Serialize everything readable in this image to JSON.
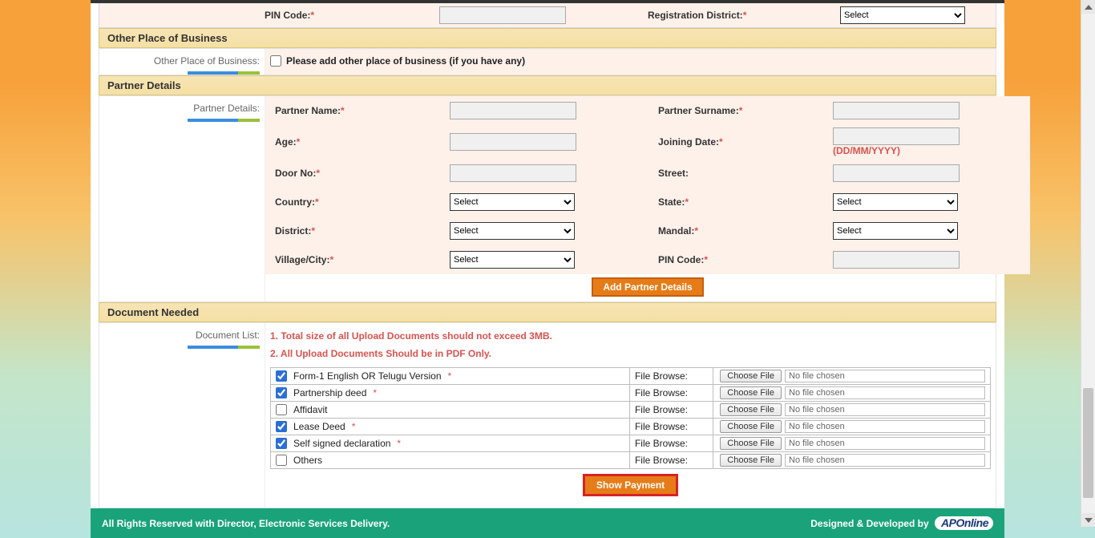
{
  "top": {
    "pin_label": "PIN Code:",
    "reg_district_label": "Registration District:",
    "select": "Select"
  },
  "other_place": {
    "section": "Other Place of Business",
    "side": "Other Place of Business:",
    "check_label": "Please add other place of business (if you have any)"
  },
  "partner": {
    "section": "Partner Details",
    "side": "Partner Details:",
    "name": "Partner Name:",
    "surname": "Partner Surname:",
    "age": "Age:",
    "joining": "Joining Date:",
    "date_hint": "(DD/MM/YYYY)",
    "door": "Door No:",
    "street": "Street:",
    "country": "Country:",
    "state": "State:",
    "district": "District:",
    "mandal": "Mandal:",
    "village": "Village/City:",
    "pin": "PIN Code:",
    "select": "Select",
    "add_btn": "Add Partner Details"
  },
  "docs": {
    "section": "Document Needed",
    "side": "Document List:",
    "warn1": "1. Total size of all Upload Documents should not exceed 3MB.",
    "warn2": "2. All Upload Documents Should be in PDF Only.",
    "file_browse": "File Browse:",
    "choose": "Choose File",
    "no_file": "No file chosen",
    "items": [
      {
        "label": "Form-1 English OR Telugu Version",
        "req": true,
        "checked": true
      },
      {
        "label": "Partnership deed",
        "req": true,
        "checked": true
      },
      {
        "label": "Affidavit",
        "req": false,
        "checked": false
      },
      {
        "label": "Lease Deed",
        "req": true,
        "checked": true
      },
      {
        "label": "Self signed declaration",
        "req": true,
        "checked": true
      },
      {
        "label": "Others",
        "req": false,
        "checked": false
      }
    ],
    "show_payment": "Show Payment"
  },
  "footer": {
    "left": "All Rights Reserved with Director, Electronic Services Delivery.",
    "right": "Designed & Developed by",
    "logo_a": "AP",
    "logo_b": "nline"
  }
}
